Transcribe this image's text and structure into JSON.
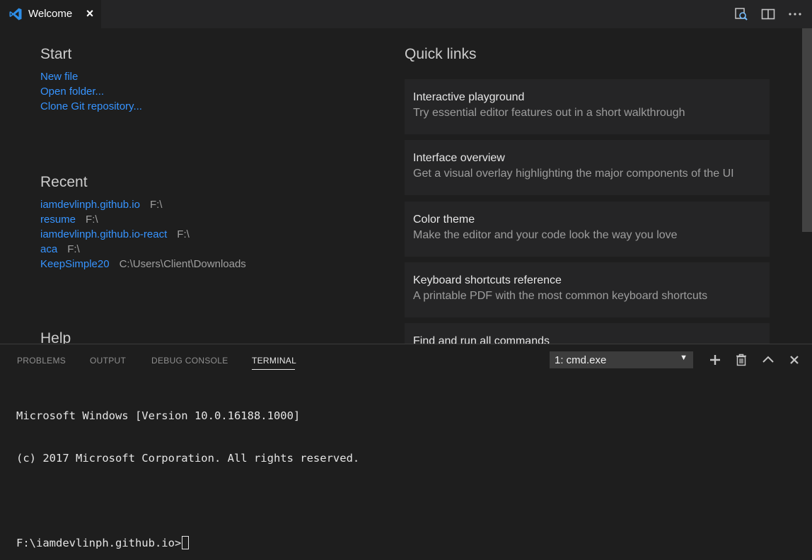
{
  "tab": {
    "title": "Welcome",
    "close_glyph": "×"
  },
  "tab_actions": [
    "open-preview-icon",
    "split-editor-icon",
    "more-actions-icon"
  ],
  "start": {
    "title": "Start",
    "links": [
      "New file",
      "Open folder...",
      "Clone Git repository..."
    ]
  },
  "recent": {
    "title": "Recent",
    "items": [
      {
        "name": "iamdevlinph.github.io",
        "path": "F:\\"
      },
      {
        "name": "resume",
        "path": "F:\\"
      },
      {
        "name": "iamdevlinph.github.io-react",
        "path": "F:\\"
      },
      {
        "name": "aca",
        "path": "F:\\"
      },
      {
        "name": "KeepSimple20",
        "path": "C:\\Users\\Client\\Downloads"
      }
    ]
  },
  "help": {
    "title": "Help"
  },
  "quick_links": {
    "title": "Quick links",
    "cards": [
      {
        "title": "Interactive playground",
        "desc": "Try essential editor features out in a short walkthrough"
      },
      {
        "title": "Interface overview",
        "desc": "Get a visual overlay highlighting the major components of the UI"
      },
      {
        "title": "Color theme",
        "desc": "Make the editor and your code look the way you love"
      },
      {
        "title": "Keyboard shortcuts reference",
        "desc": "A printable PDF with the most common keyboard shortcuts"
      },
      {
        "title": "Find and run all commands",
        "desc": ""
      }
    ]
  },
  "panel": {
    "tabs": [
      "PROBLEMS",
      "OUTPUT",
      "DEBUG CONSOLE",
      "TERMINAL"
    ],
    "active_tab": "TERMINAL",
    "terminal_select": "1: cmd.exe",
    "actions": [
      "add-icon",
      "trash-icon",
      "chevron-up-icon",
      "close-icon"
    ]
  },
  "terminal": {
    "lines": [
      "Microsoft Windows [Version 10.0.16188.1000]",
      "(c) 2017 Microsoft Corporation. All rights reserved.",
      "",
      "F:\\iamdevlinph.github.io>"
    ]
  },
  "colors": {
    "link": "#3794ff",
    "background": "#1e1e1e",
    "card": "#252526",
    "brand": "#0078d4"
  }
}
